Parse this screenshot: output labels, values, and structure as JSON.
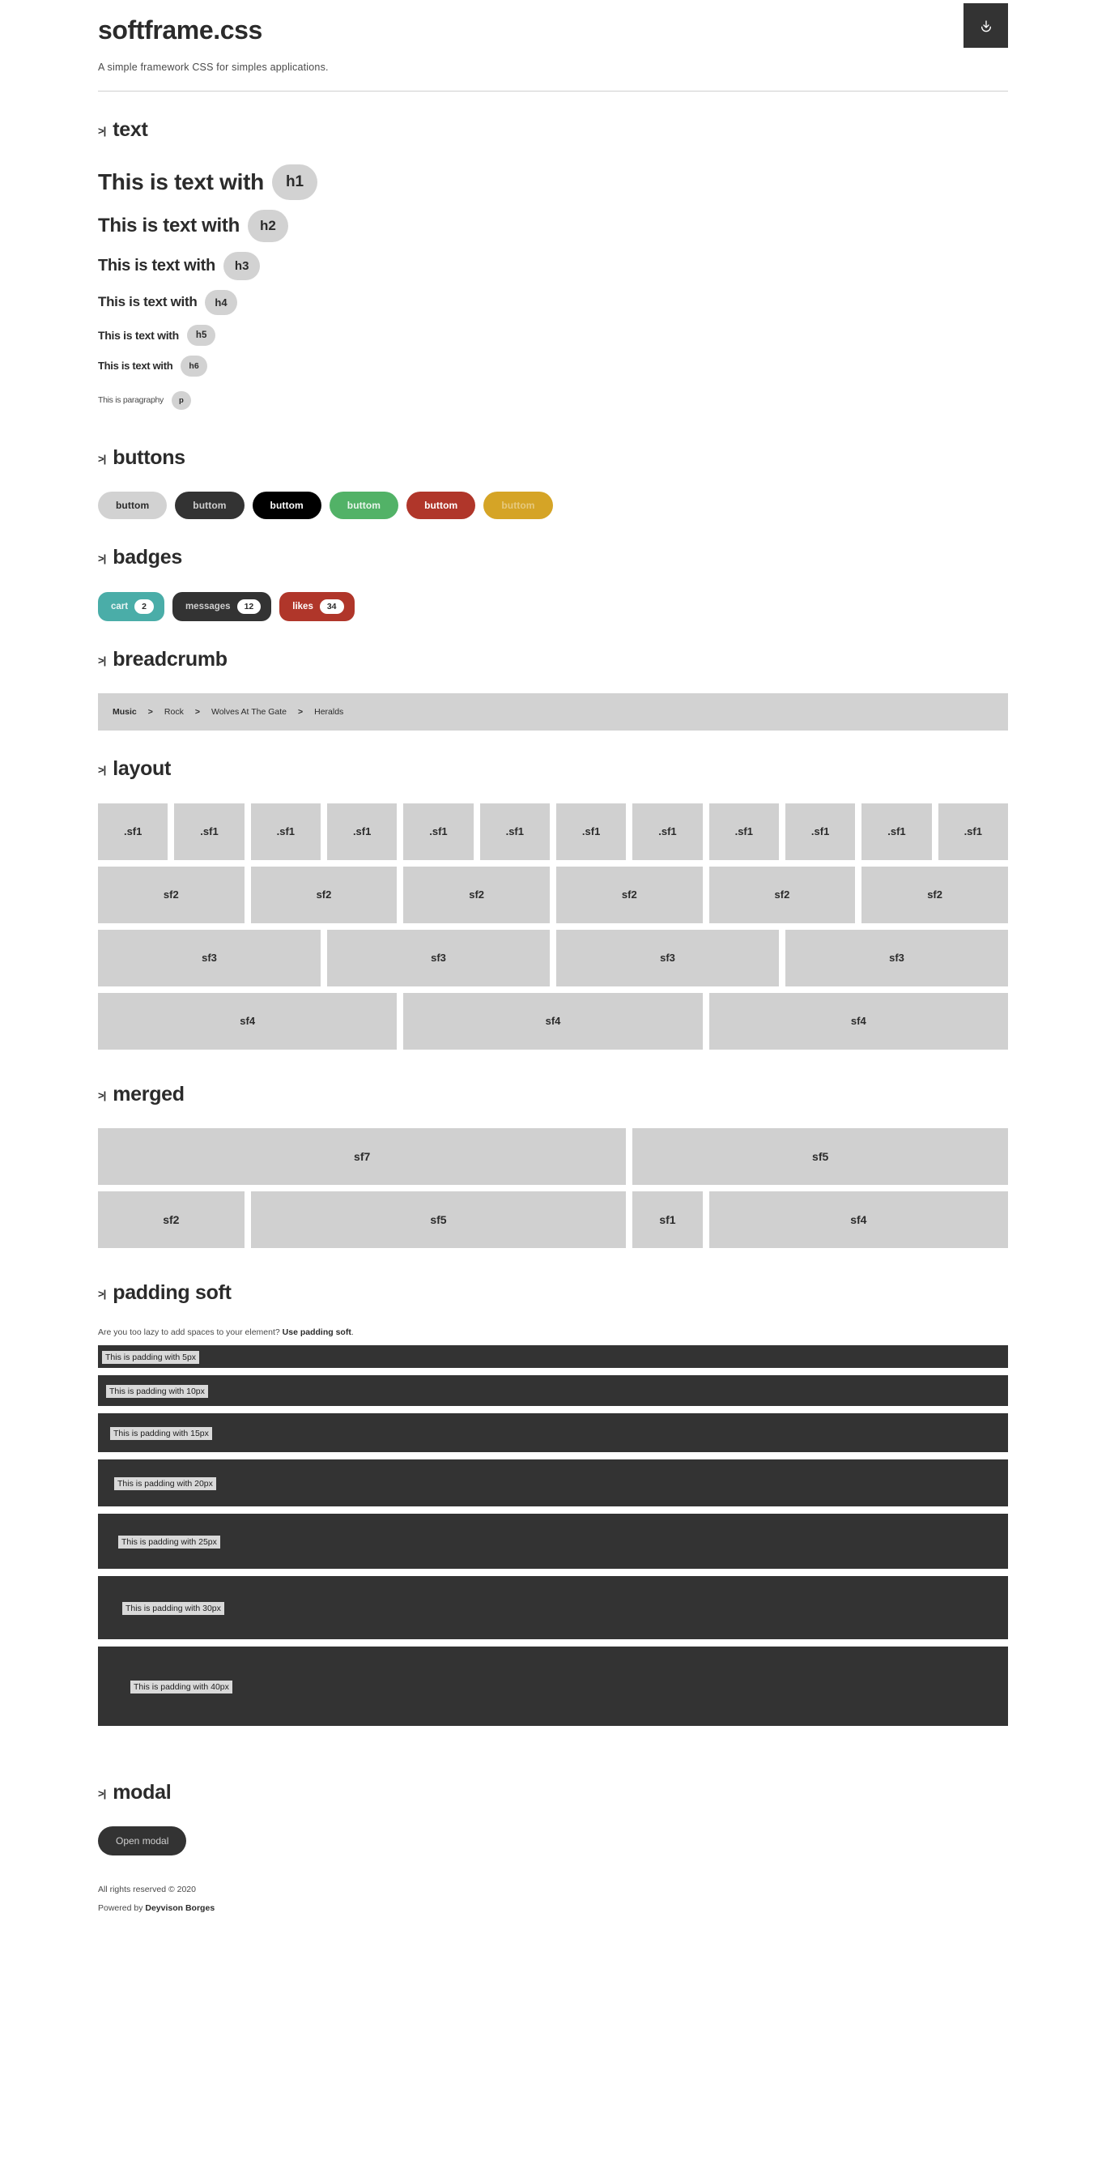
{
  "header": {
    "title": "softframe.css",
    "subtitle": "A simple framework CSS for simples applications.",
    "download_icon": "download-icon"
  },
  "sections": {
    "prompt_glyph": ">|",
    "text": "text",
    "buttons": "buttons",
    "badges": "badges",
    "breadcrumb": "breadcrumb",
    "layout": "layout",
    "merged": "merged",
    "padding_soft": "padding soft",
    "modal": "modal"
  },
  "text_samples": [
    {
      "label": "This is text with",
      "tag": "h1"
    },
    {
      "label": "This is text with",
      "tag": "h2"
    },
    {
      "label": "This is text with",
      "tag": "h3"
    },
    {
      "label": "This is text with",
      "tag": "h4"
    },
    {
      "label": "This is text with",
      "tag": "h5"
    },
    {
      "label": "This is text with",
      "tag": "h6"
    },
    {
      "label": "This is paragraphy",
      "tag": "p"
    }
  ],
  "buttons": [
    {
      "label": "buttom",
      "variant": "default",
      "color": "#d2d2d2"
    },
    {
      "label": "buttom",
      "variant": "dark",
      "color": "#333333"
    },
    {
      "label": "buttom",
      "variant": "black",
      "color": "#000000"
    },
    {
      "label": "buttom",
      "variant": "green",
      "color": "#52b267"
    },
    {
      "label": "buttom",
      "variant": "red",
      "color": "#b0362a"
    },
    {
      "label": "buttom",
      "variant": "yellow",
      "color": "#d5a426"
    }
  ],
  "badges": [
    {
      "label": "cart",
      "count": "2",
      "color": "#4aada8"
    },
    {
      "label": "messages",
      "count": "12",
      "color": "#333333"
    },
    {
      "label": "likes",
      "count": "34",
      "color": "#b0362a"
    }
  ],
  "breadcrumb": {
    "separator": ">",
    "items": [
      "Music",
      "Rock",
      "Wolves At The Gate",
      "Heralds"
    ]
  },
  "layout": {
    "row1": [
      ".sf1",
      ".sf1",
      ".sf1",
      ".sf1",
      ".sf1",
      ".sf1",
      ".sf1",
      ".sf1",
      ".sf1",
      ".sf1",
      ".sf1",
      ".sf1"
    ],
    "row2": [
      "sf2",
      "sf2",
      "sf2",
      "sf2",
      "sf2",
      "sf2"
    ],
    "row3": [
      "sf3",
      "sf3",
      "sf3",
      "sf3"
    ],
    "row4": [
      "sf4",
      "sf4",
      "sf4"
    ]
  },
  "merged": {
    "row1": [
      "sf7",
      "sf5"
    ],
    "row2": [
      "sf2",
      "sf5",
      "sf1",
      "sf4"
    ]
  },
  "padding_soft": {
    "intro_plain": "Are you too lazy to add spaces to your element? ",
    "intro_strong": "Use padding soft",
    "intro_end": ".",
    "items": [
      {
        "label": "This is padding with 5px",
        "size": "5px"
      },
      {
        "label": "This is padding with 10px",
        "size": "10px"
      },
      {
        "label": "This is padding with 15px",
        "size": "15px"
      },
      {
        "label": "This is padding with 20px",
        "size": "20px"
      },
      {
        "label": "This is padding with 25px",
        "size": "25px"
      },
      {
        "label": "This is padding with 30px",
        "size": "30px"
      },
      {
        "label": "This is padding with 40px",
        "size": "40px"
      }
    ]
  },
  "modal": {
    "open_label": "Open modal"
  },
  "footer": {
    "rights": "All rights reserved © 2020",
    "powered_prefix": "Powered by ",
    "author": "Deyvison Borges"
  }
}
